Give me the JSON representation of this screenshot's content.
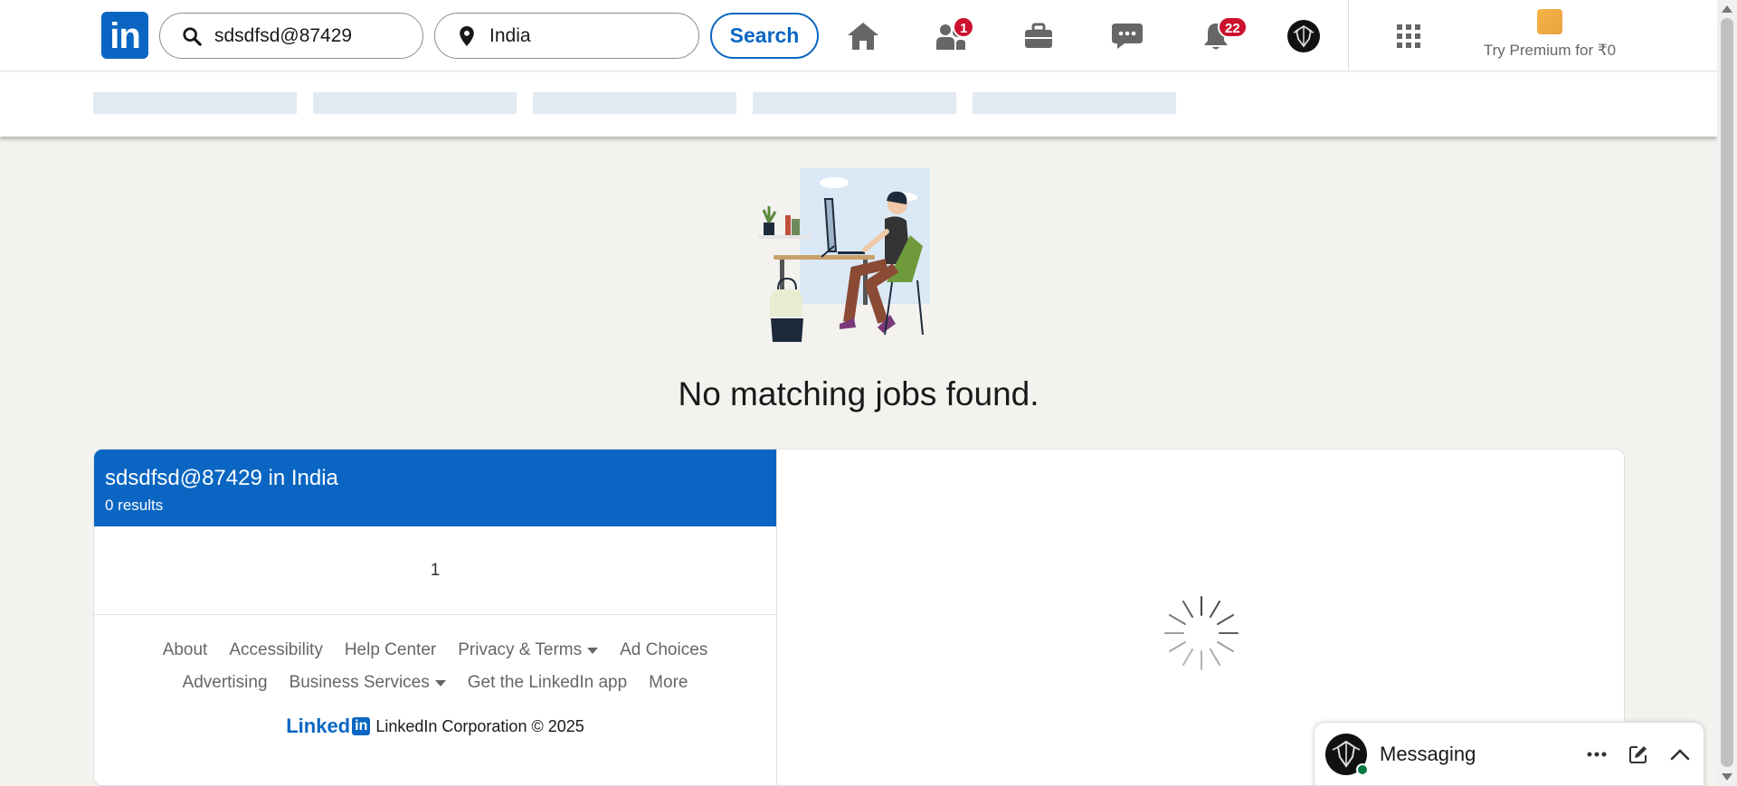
{
  "nav": {
    "logo_text": "in",
    "keyword_value": "sdsdfsd@87429",
    "location_value": "India",
    "search_label": "Search",
    "network_badge": "1",
    "notifications_badge": "22",
    "premium_label": "Try Premium for ₹0"
  },
  "empty_state": {
    "title": "No matching jobs found."
  },
  "results": {
    "query": "sdsdfsd@87429 in India",
    "count": "0 results",
    "page": "1"
  },
  "footer": {
    "row1": [
      "About",
      "Accessibility",
      "Help Center",
      "Privacy & Terms",
      "Ad Choices"
    ],
    "row2": [
      "Advertising",
      "Business Services",
      "Get the LinkedIn app",
      "More"
    ],
    "brand_word": "Linked",
    "brand_in": "in",
    "copyright": "LinkedIn Corporation © 2025"
  },
  "messaging": {
    "label": "Messaging"
  },
  "colors": {
    "brand_blue": "#0a66c2",
    "badge_red": "#cb112d",
    "online_green": "#057642"
  }
}
